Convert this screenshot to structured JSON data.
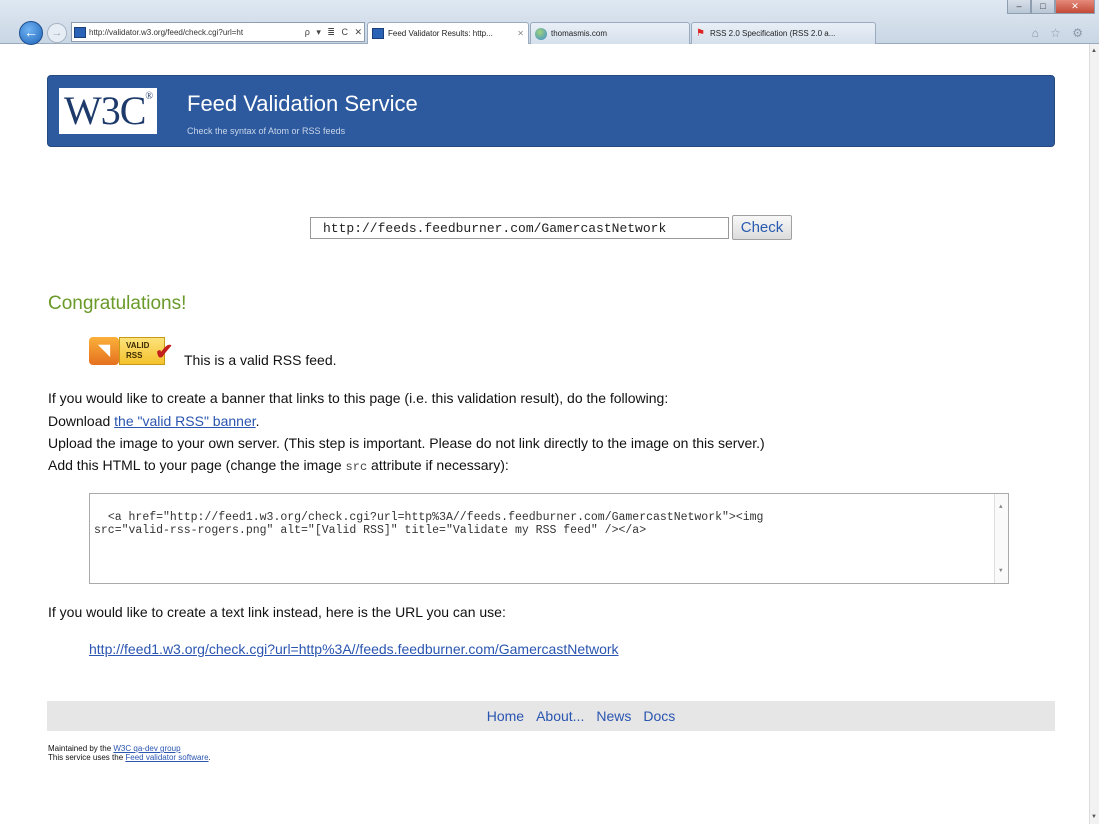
{
  "browser": {
    "address_url": "http://validator.w3.org/feed/check.cgi?url=ht",
    "address_icons": "ρ ▾ ≣ C ✕",
    "tabs": [
      {
        "label": "Feed Validator Results: http...",
        "active": true
      },
      {
        "label": "thomasmis.com",
        "active": false
      },
      {
        "label": "RSS 2.0 Specification (RSS 2.0 a...",
        "active": false
      }
    ],
    "tab_close": "✕",
    "tools": "⌂ ☆ ⚙",
    "window_controls": {
      "minimize": "–",
      "maximize": "□",
      "close": "✕"
    }
  },
  "header": {
    "logo_text": "W3C",
    "logo_mark": "®",
    "title": "Feed Validation Service",
    "subtitle": "Check the syntax of Atom or RSS feeds"
  },
  "form": {
    "url_value": "http://feeds.feedburner.com/GamercastNetwork",
    "check_label": "Check"
  },
  "result": {
    "heading": "Congratulations!",
    "badge_line1": "VALID",
    "badge_line2": "RSS",
    "valid_message": "This is a valid RSS feed."
  },
  "banner_instructions": {
    "intro": "If you would like to create a banner that links to this page (i.e. this validation result), do the following:",
    "download_prefix": "Download ",
    "download_link": "the \"valid RSS\" banner",
    "download_suffix": ".",
    "upload": "Upload the image to your own server. (This step is important. Please do not link directly to the image on this server.)",
    "add_html_prefix": "Add this HTML to your page (change the image ",
    "add_html_code": "src",
    "add_html_suffix": " attribute if necessary):",
    "code_snippet": "<a href=\"http://feed1.w3.org/check.cgi?url=http%3A//feeds.feedburner.com/GamercastNetwork\"><img\nsrc=\"valid-rss-rogers.png\" alt=\"[Valid RSS]\" title=\"Validate my RSS feed\" /></a>"
  },
  "text_link_section": {
    "intro": "If you would like to create a text link instead, here is the URL you can use:",
    "url": "http://feed1.w3.org/check.cgi?url=http%3A//feeds.feedburner.com/GamercastNetwork"
  },
  "footer": {
    "links": [
      "Home",
      "About...",
      "News",
      "Docs"
    ],
    "maintained_prefix": "Maintained by the ",
    "maintained_link": "W3C qa-dev group",
    "software_prefix": "This service uses the ",
    "software_link": "Feed validator software",
    "software_suffix": "."
  }
}
